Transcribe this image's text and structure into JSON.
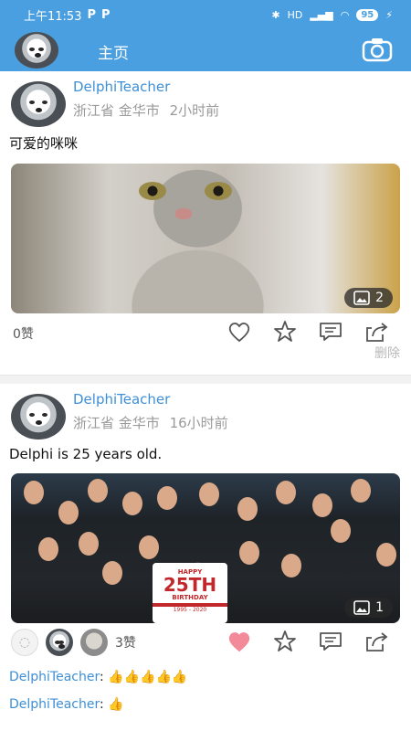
{
  "statusbar": {
    "time": "上午11:53",
    "notif_icons": [
      "P",
      "P"
    ],
    "battery": "95",
    "signal_label": "HD"
  },
  "appbar": {
    "title": "主页"
  },
  "posts": [
    {
      "author": "DelphiTeacher",
      "location": "浙江省 金华市",
      "time_ago": "2小时前",
      "text": "可爱的咪咪",
      "image_count": "2",
      "likes_label": "0赞",
      "delete_label": "删除"
    },
    {
      "author": "DelphiTeacher",
      "location": "浙江省 金华市",
      "time_ago": "16小时前",
      "text": "Delphi is 25 years old.",
      "image_count": "1",
      "likes_label": "3赞",
      "cake": {
        "line1": "HAPPY",
        "line2": "25TH",
        "line3": "BIRTHDAY",
        "line4": "1995 - 2020"
      },
      "comments": [
        {
          "who": "DelphiTeacher",
          "sep": ":",
          "text": "👍👍👍👍👍"
        },
        {
          "who": "DelphiTeacher",
          "sep": ":",
          "text": "👍"
        }
      ]
    }
  ],
  "colors": {
    "primary": "#4a9fe0",
    "link": "#3e8fd6",
    "liked_heart": "#f28a9a"
  }
}
